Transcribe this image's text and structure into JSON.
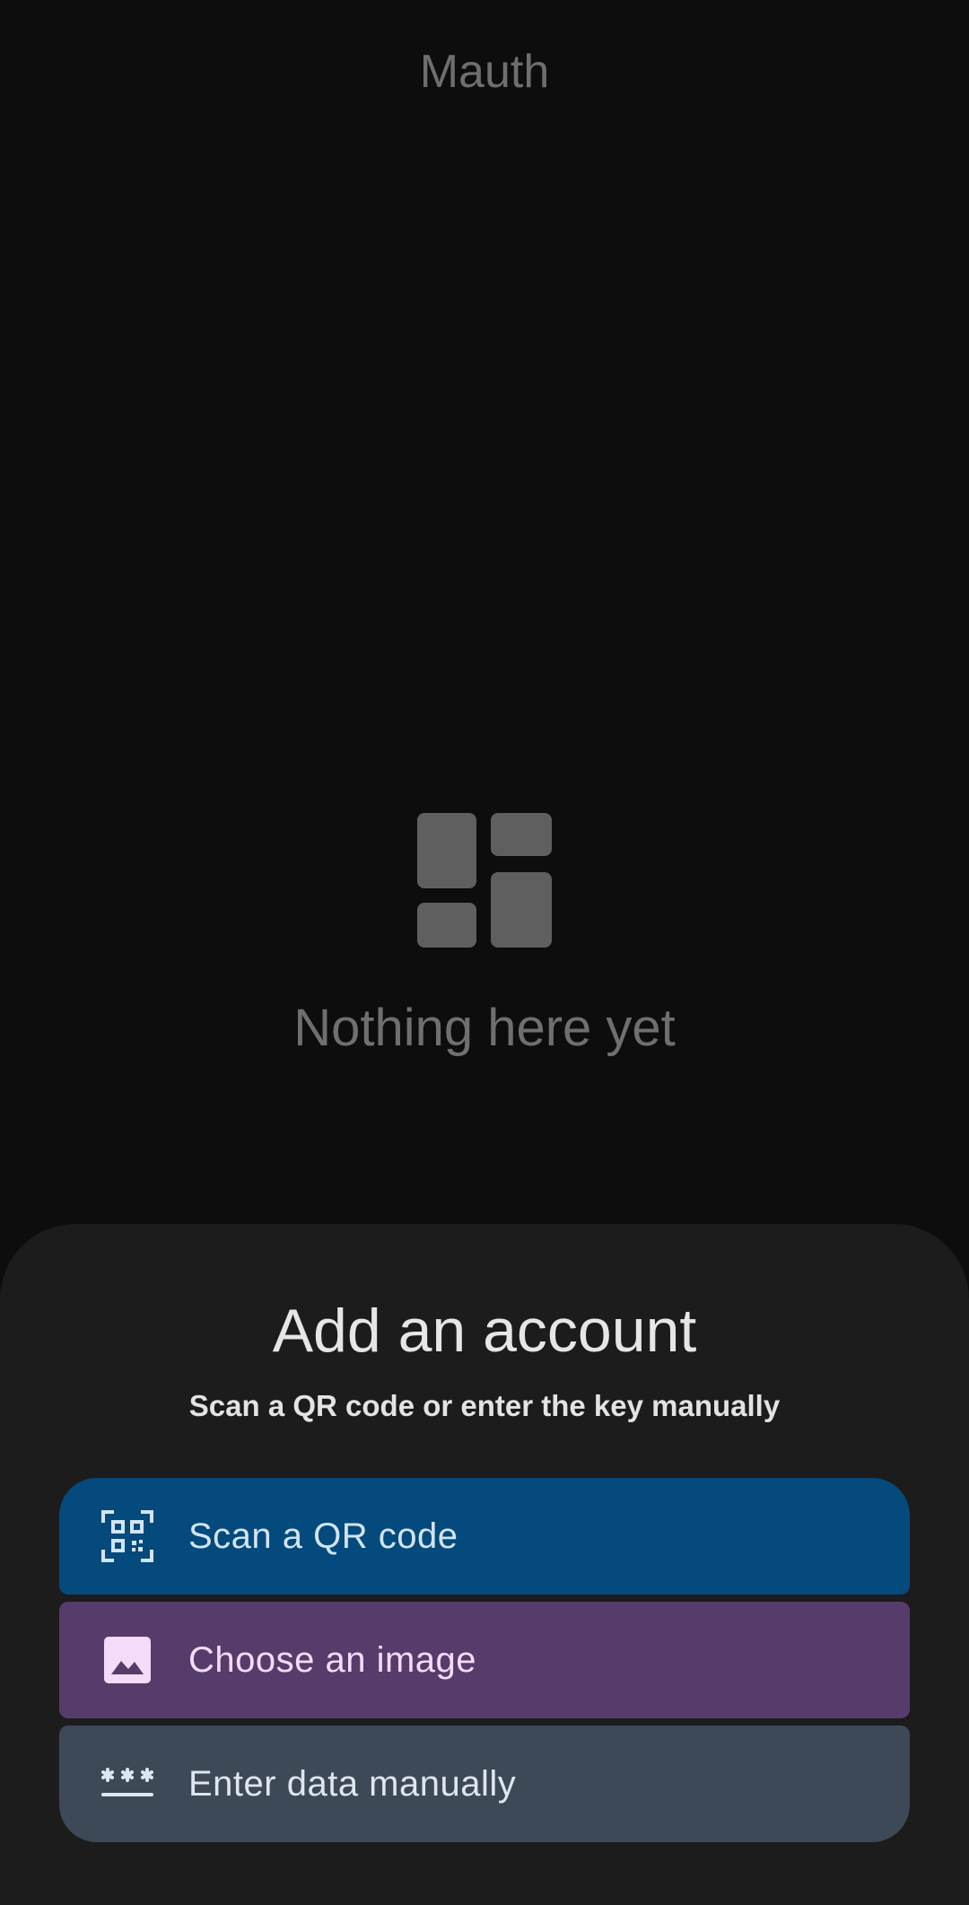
{
  "app": {
    "title": "Mauth"
  },
  "empty_state": {
    "icon": "dashboard-icon",
    "text": "Nothing here yet"
  },
  "sheet": {
    "title": "Add an account",
    "subtitle": "Scan a QR code or enter the key manually",
    "options": [
      {
        "label": "Scan a QR code",
        "icon": "qr-code-scanner-icon",
        "color": "#044a7c"
      },
      {
        "label": "Choose an image",
        "icon": "image-icon",
        "color": "#563c6b"
      },
      {
        "label": "Enter data manually",
        "icon": "password-icon",
        "color": "#3d4957"
      }
    ]
  }
}
